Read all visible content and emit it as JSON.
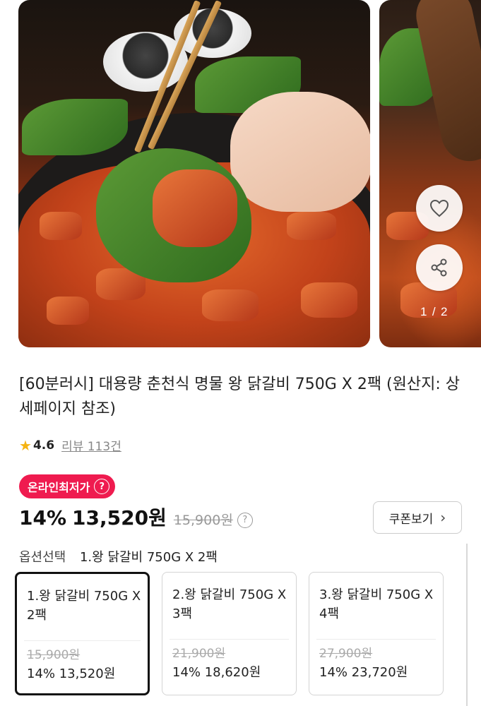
{
  "carousel": {
    "page_current": "1",
    "page_total": "2",
    "page_separator": "/"
  },
  "product": {
    "title": "[60분러시] 대용량 춘천식 명물 왕 닭갈비 750G X 2팩 (원산지: 상세페이지 참조)",
    "rating": "4.6",
    "reviews": "리뷰 113건"
  },
  "price": {
    "badge": "온라인최저가",
    "discount": "14%",
    "sale_price": "13,520원",
    "original_price": "15,900원"
  },
  "coupon": {
    "label": "쿠폰보기"
  },
  "options": {
    "label": "옵션선택",
    "selected_value": "1.왕 닭갈비 750G X 2팩",
    "items": [
      {
        "name": "1.왕 닭갈비 750G X 2팩",
        "original": "15,900원",
        "price": "14% 13,520원",
        "selected": true
      },
      {
        "name": "2.왕 닭갈비 750G X 3팩",
        "original": "21,900원",
        "price": "14% 18,620원",
        "selected": false
      },
      {
        "name": "3.왕 닭갈비 750G X 4팩",
        "original": "27,900원",
        "price": "14% 23,720원",
        "selected": false
      }
    ]
  },
  "colors": {
    "badge_bg": "#ef1b4f",
    "star": "#f5b312",
    "selected_border": "#111111"
  },
  "icons": {
    "heart": "heart-icon",
    "share": "share-icon",
    "star": "star-icon",
    "question": "question-icon",
    "info": "info-icon",
    "chevron": "chevron-right-icon"
  }
}
